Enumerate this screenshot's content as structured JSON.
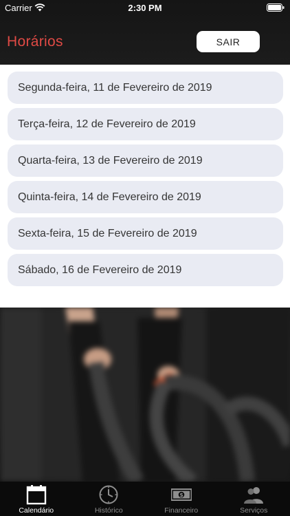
{
  "status_bar": {
    "carrier": "Carrier",
    "time": "2:30 PM"
  },
  "header": {
    "title": "Horários",
    "logout_label": "SAIR"
  },
  "days": [
    "Segunda-feira, 11 de Fevereiro de 2019",
    "Terça-feira, 12 de Fevereiro de 2019",
    "Quarta-feira, 13 de Fevereiro de 2019",
    "Quinta-feira, 14 de Fevereiro de 2019",
    "Sexta-feira, 15 de Fevereiro de 2019",
    "Sábado, 16 de Fevereiro de 2019"
  ],
  "tabs": [
    {
      "label": "Calendário",
      "icon": "calendar-icon",
      "active": true
    },
    {
      "label": "Histórico",
      "icon": "clock-icon",
      "active": false
    },
    {
      "label": "Financeiro",
      "icon": "money-icon",
      "active": false
    },
    {
      "label": "Serviços",
      "icon": "people-icon",
      "active": false
    }
  ],
  "colors": {
    "title": "#e04a45",
    "header_bg": "#1a1a1a",
    "list_item_bg": "#e9ebf3",
    "tab_active": "#ffffff",
    "tab_inactive": "#8e8e8e"
  }
}
